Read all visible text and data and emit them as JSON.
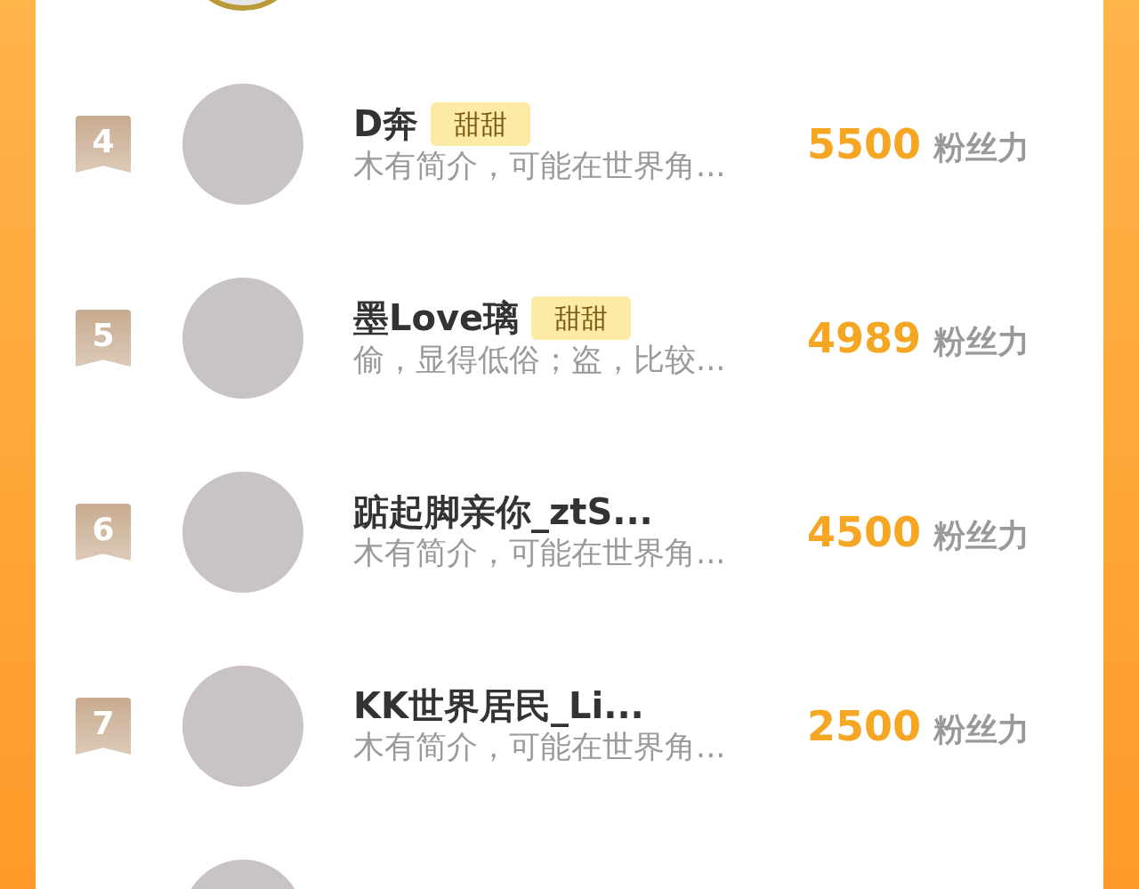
{
  "rankings": [
    {
      "avatar_framed": true
    },
    {
      "rank": "4",
      "name": "D奔",
      "badge": "甜甜",
      "bio": "木有简介，可能在世界角...",
      "score": "5500",
      "score_unit": "粉丝力",
      "avatar_framed": false
    },
    {
      "rank": "5",
      "name": "墨Love璃",
      "badge": "甜甜",
      "bio": "偷，显得低俗；盗，比较...",
      "score": "4989",
      "score_unit": "粉丝力",
      "avatar_framed": false
    },
    {
      "rank": "6",
      "name": "踮起脚亲你_ztS...",
      "bio": "木有简介，可能在世界角...",
      "score": "4500",
      "score_unit": "粉丝力",
      "avatar_framed": false
    },
    {
      "rank": "7",
      "name": "KK世界居民_Li...",
      "bio": "木有简介，可能在世界角...",
      "score": "2500",
      "score_unit": "粉丝力",
      "avatar_framed": false
    },
    {
      "avatar_framed": false
    }
  ]
}
